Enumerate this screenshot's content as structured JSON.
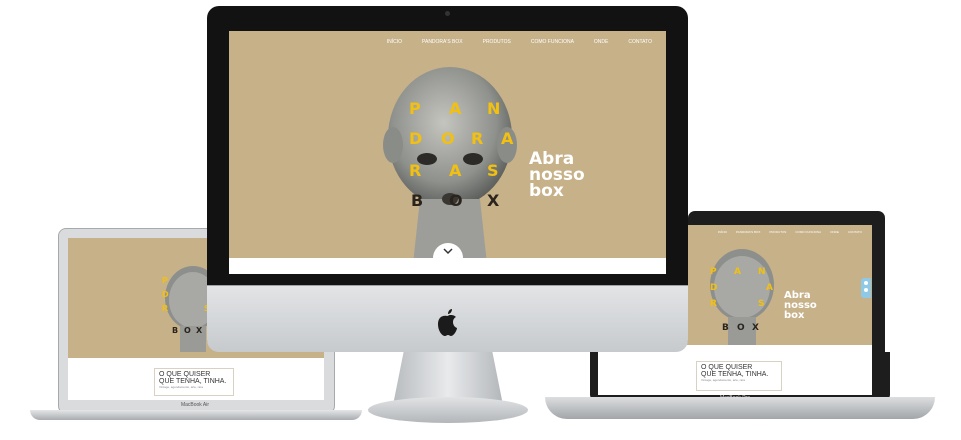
{
  "site": {
    "nav": [
      "INÍCIO",
      "PANDORA'S BOX",
      "PRODUTOS",
      "COMO FUNCIONA",
      "ONDE",
      "CONTATO"
    ],
    "logo_letters": {
      "row1": [
        "P",
        "A",
        "N"
      ],
      "row2": [
        "D",
        "O",
        "R",
        "A"
      ],
      "row3": [
        "R",
        "A",
        "S"
      ],
      "row4": [
        "B",
        "O",
        "X"
      ]
    },
    "tagline": "Abra\nnosso\nbox",
    "section_title_line1": "O QUE QUISER",
    "section_title_line2": "QUE TENHA, TINHA.",
    "section_sub": "Vintage, agendamento, arte, rara",
    "colors": {
      "background": "#c7b189",
      "accent_yellow": "#f2c010",
      "text_dark": "#2a241d"
    }
  },
  "devices": {
    "macbook_air_label": "MacBook Air",
    "macbook_pro_label": "MacBook Pro",
    "imac_logo": "apple-icon"
  }
}
